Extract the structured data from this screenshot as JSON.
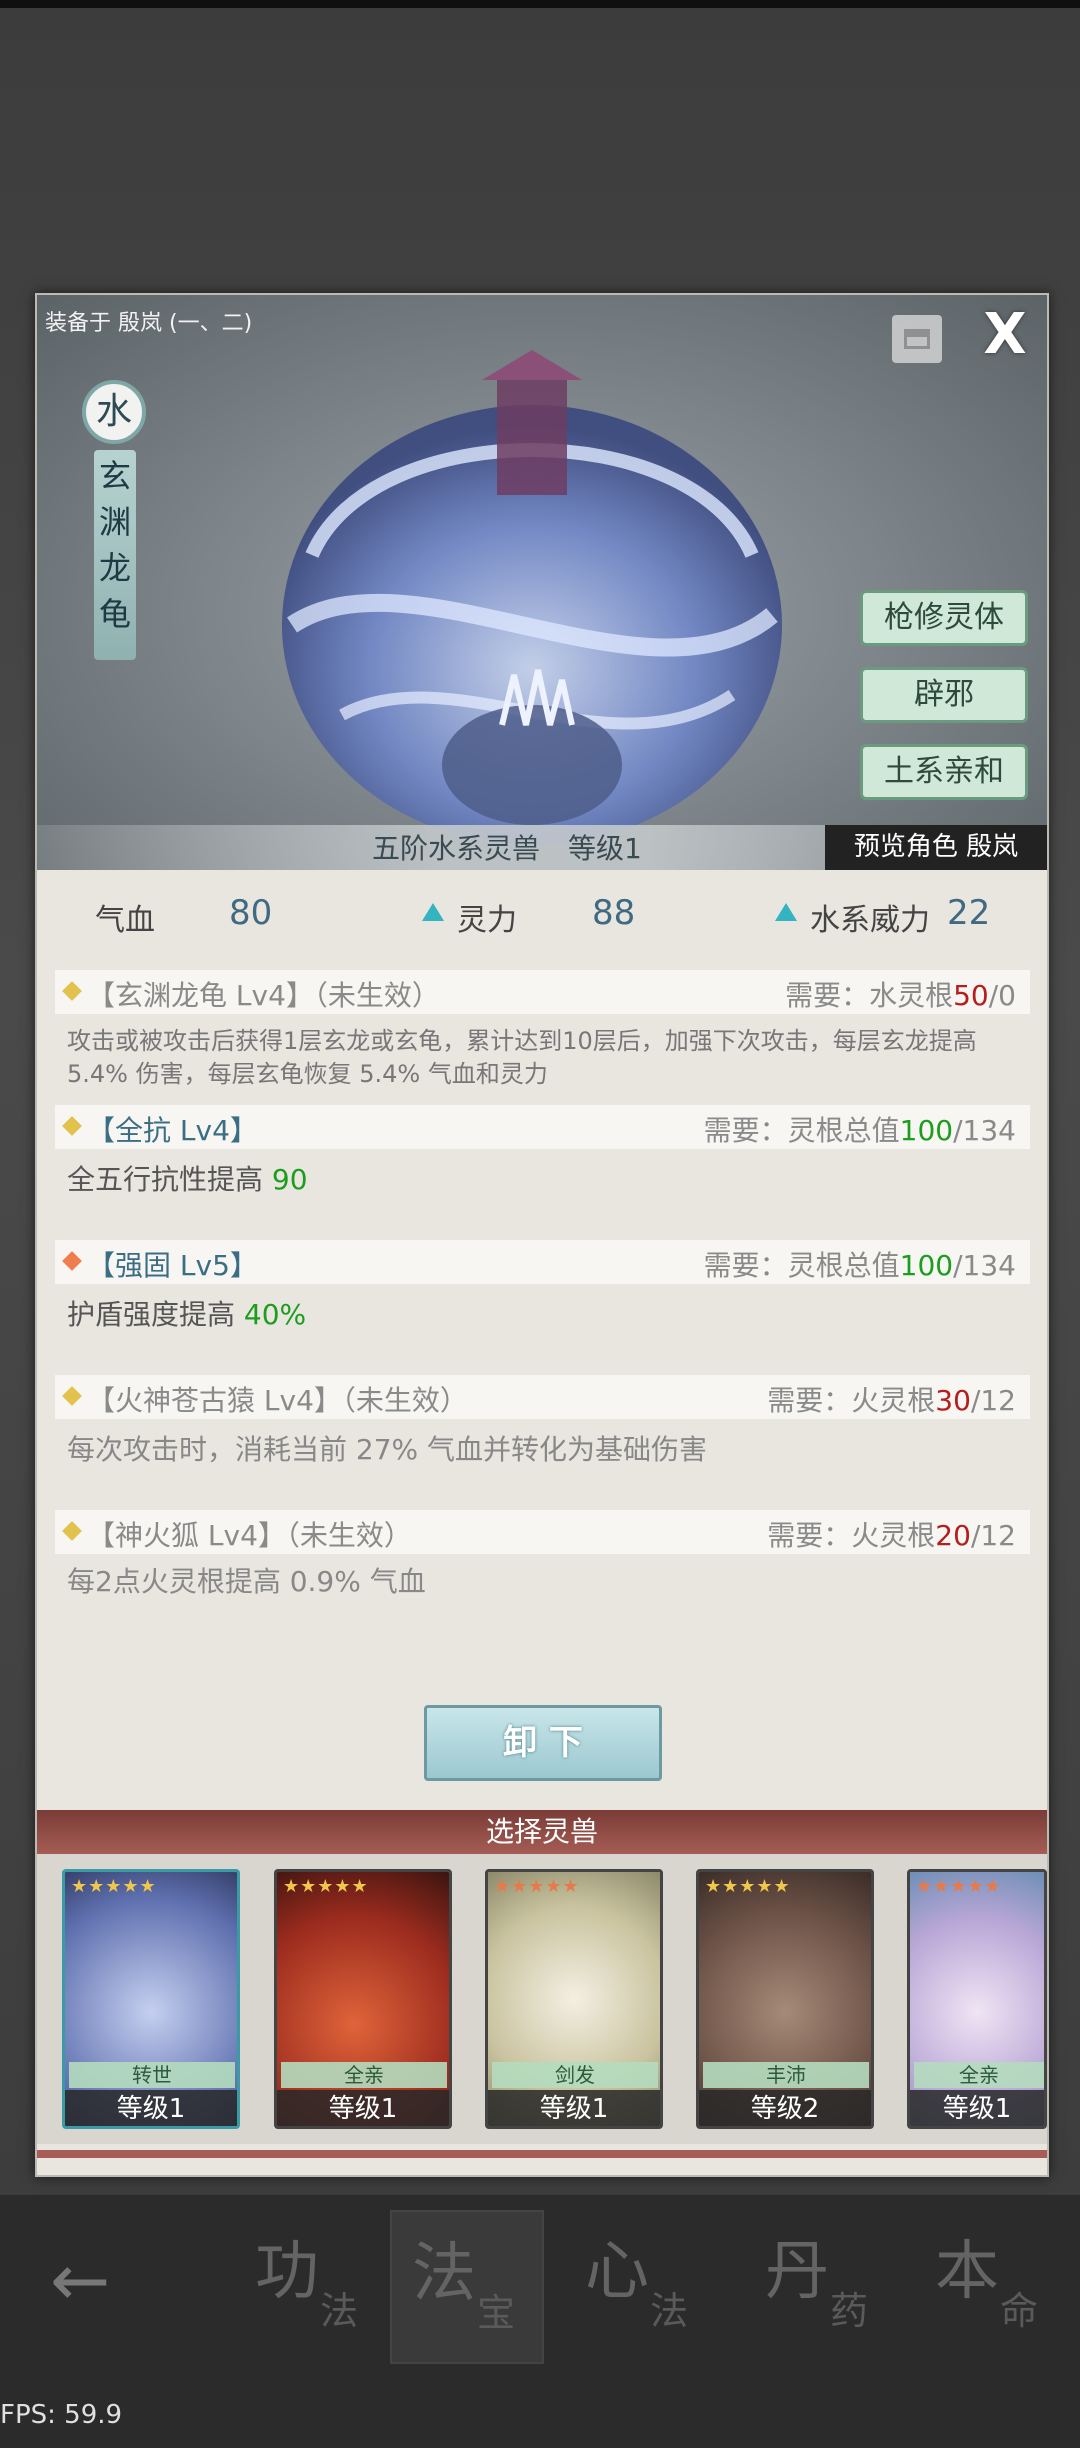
{
  "equipped_on": "装备于 殷岚 (一、二)",
  "close_label": "X",
  "element": "水",
  "beast_name_chars": [
    "玄",
    "渊",
    "龙",
    "龟"
  ],
  "traits": [
    "枪修灵体",
    "辟邪",
    "土系亲和"
  ],
  "tier_line": "五阶水系灵兽　等级1",
  "preview": "预览角色 殷岚",
  "stats": {
    "hp_label": "气血",
    "hp_value": "80",
    "spirit_label": "灵力",
    "spirit_value": "88",
    "water_label": "水系威力",
    "water_value": "22"
  },
  "skills": [
    {
      "name": "【玄渊龙龟 Lv4】（未生效）",
      "req_prefix": "需要：水灵根",
      "req_have": "50",
      "req_total": "/0",
      "desc": "攻击或被攻击后获得1层玄龙或玄龟，累计达到10层后，加强下次攻击，每层玄龙提高 5.4% 伤害，每层玄龟恢复 5.4% 气血和灵力"
    },
    {
      "name": "【全抗 Lv4】",
      "req_prefix": "需要：灵根总值",
      "req_have": "100",
      "req_total": "/134",
      "desc_prefix": "全五行抗性提高 ",
      "desc_value": "90"
    },
    {
      "name": "【强固 Lv5】",
      "req_prefix": "需要：灵根总值",
      "req_have": "100",
      "req_total": "/134",
      "desc_prefix": "护盾强度提高 ",
      "desc_value": "40%"
    },
    {
      "name": "【火神苍古猿 Lv4】（未生效）",
      "req_prefix": "需要：火灵根",
      "req_have": "30",
      "req_total": "/12",
      "desc": "每次攻击时，消耗当前 27% 气血并转化为基础伤害"
    },
    {
      "name": "【神火狐 Lv4】（未生效）",
      "req_prefix": "需要：火灵根",
      "req_have": "20",
      "req_total": "/12",
      "desc": "每2点火灵根提高 0.9% 气血"
    }
  ],
  "unequip_label": "卸 下",
  "select_title": "选择灵兽",
  "cards": [
    {
      "tag": "转世",
      "level": "等级1",
      "stars": "★★★★★"
    },
    {
      "tag": "全亲",
      "level": "等级1",
      "stars": "★★★★★"
    },
    {
      "tag": "剑发",
      "level": "等级1",
      "stars": "★★★★★"
    },
    {
      "tag": "丰沛",
      "level": "等级2",
      "stars": "★★★★★"
    },
    {
      "tag": "全亲",
      "level": "等级1",
      "stars": "★★★★★"
    }
  ],
  "nav": [
    {
      "big": "功",
      "small": "法"
    },
    {
      "big": "法",
      "small": "宝"
    },
    {
      "big": "心",
      "small": "法"
    },
    {
      "big": "丹",
      "small": "药"
    },
    {
      "big": "本",
      "small": "命"
    }
  ],
  "fps": "FPS: 59.9",
  "colors": {
    "accent_teal": "#34b3c0",
    "req_green": "#1d9d1d",
    "req_red": "#b61e1e",
    "select_bar": "#a55d55"
  }
}
